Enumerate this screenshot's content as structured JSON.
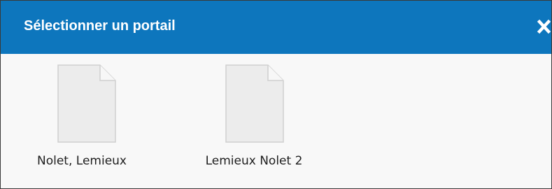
{
  "dialog": {
    "title": "Sélectionner un portail",
    "close_icon": "close-icon",
    "colors": {
      "titlebar": "#0d76bd",
      "title_text": "#ffffff",
      "body": "#f8f8f8"
    }
  },
  "portals": [
    {
      "label": "Nolet, Lemieux",
      "icon": "document-icon"
    },
    {
      "label": "Lemieux Nolet 2",
      "icon": "document-icon"
    }
  ]
}
